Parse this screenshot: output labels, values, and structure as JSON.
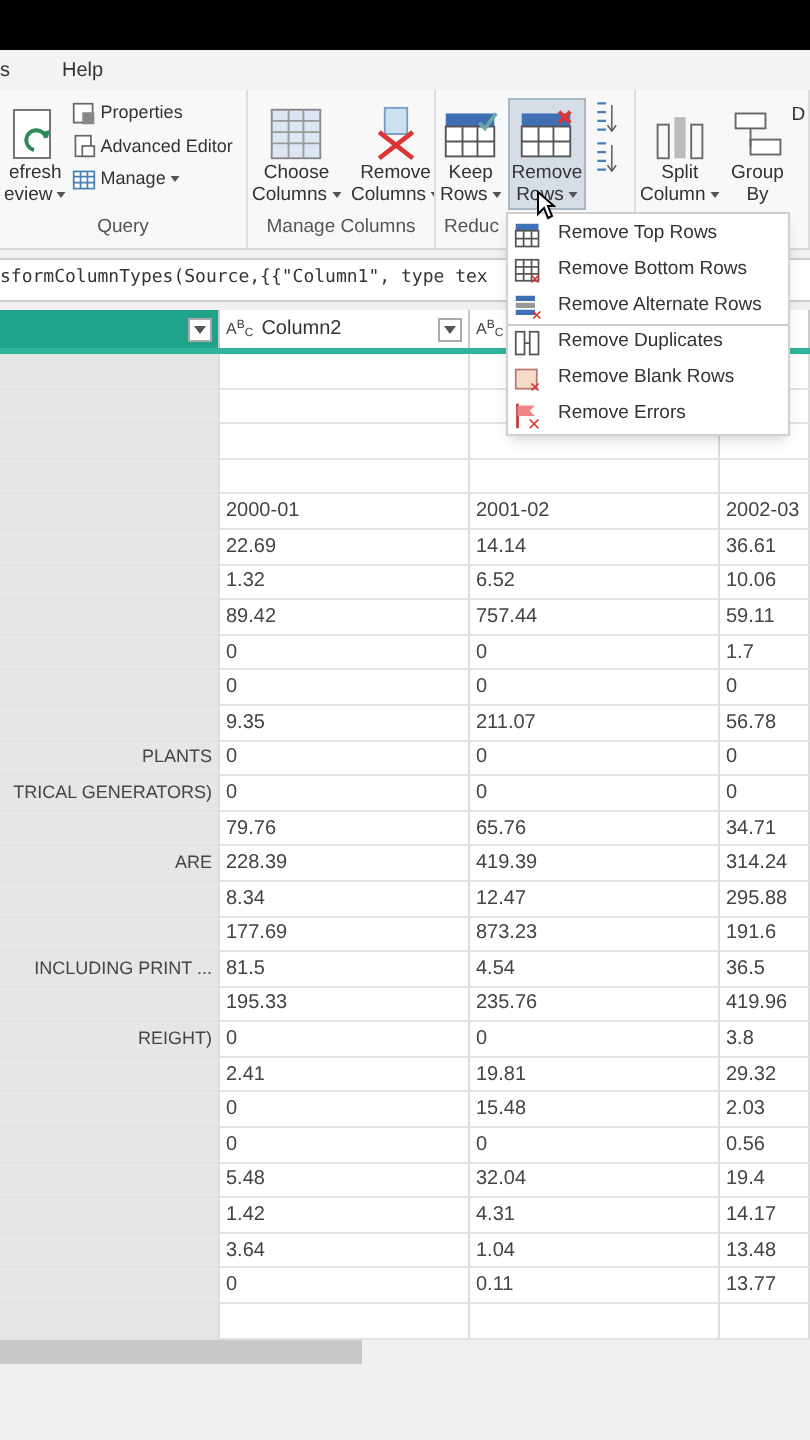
{
  "menu": [
    {
      "label": "s"
    },
    {
      "label": "Help"
    }
  ],
  "ribbon": {
    "groups": [
      {
        "label": "Query",
        "items": [
          {
            "kind": "large",
            "lines": [
              "efresh",
              "eview"
            ],
            "dropdown": true,
            "highlighted": false
          },
          {
            "kind": "stack",
            "entries": [
              {
                "label": "Properties",
                "dropdown": false
              },
              {
                "label": "Advanced Editor",
                "dropdown": false
              },
              {
                "label": "Manage",
                "dropdown": true
              }
            ]
          }
        ]
      },
      {
        "label": "Manage Columns",
        "items": [
          {
            "kind": "large",
            "lines": [
              "Choose",
              "Columns"
            ],
            "dropdown": true,
            "highlighted": false
          },
          {
            "kind": "large",
            "lines": [
              "Remove",
              "Columns"
            ],
            "dropdown": true,
            "highlighted": false
          }
        ]
      },
      {
        "label": "Reduc",
        "items": [
          {
            "kind": "large",
            "lines": [
              "Keep",
              "Rows"
            ],
            "dropdown": true,
            "highlighted": false
          },
          {
            "kind": "large",
            "lines": [
              "Remove",
              "Rows"
            ],
            "dropdown": true,
            "highlighted": true
          },
          {
            "kind": "sort"
          }
        ]
      },
      {
        "items": [
          {
            "kind": "large",
            "lines": [
              "Split",
              "Column"
            ],
            "dropdown": true,
            "highlighted": false
          },
          {
            "kind": "large",
            "lines": [
              "Group",
              "By"
            ],
            "dropdown": false,
            "highlighted": false
          },
          {
            "kind": "partial",
            "label": "D"
          }
        ]
      }
    ]
  },
  "formula": "sformColumnTypes(Source,{{\"Column1\", type tex",
  "dropdown_menu": [
    {
      "label": "Remove Top Rows",
      "separator_before": false
    },
    {
      "label": "Remove Bottom Rows",
      "separator_before": false
    },
    {
      "label": "Remove Alternate Rows",
      "separator_before": false
    },
    {
      "label": "Remove Duplicates",
      "separator_before": true
    },
    {
      "label": "Remove Blank Rows",
      "separator_before": false
    },
    {
      "label": "Remove Errors",
      "separator_before": false
    }
  ],
  "table": {
    "columns": [
      {},
      {
        "type_label": "A$^{B}$$_{C}$",
        "label": "Column2"
      },
      {
        "type_label": "A$^{B}$$_{C}$"
      },
      {}
    ],
    "rows": [
      [
        "",
        "",
        "",
        ""
      ],
      [
        "",
        "",
        "",
        ""
      ],
      [
        "",
        "",
        "",
        ""
      ],
      [
        "",
        "",
        "",
        ""
      ],
      [
        "",
        "2000-01",
        "2001-02",
        "2002-03"
      ],
      [
        "",
        "22.69",
        "14.14",
        "36.61"
      ],
      [
        "",
        "1.32",
        "6.52",
        "10.06"
      ],
      [
        "",
        "89.42",
        "757.44",
        "59.11"
      ],
      [
        "",
        "0",
        "0",
        "1.7"
      ],
      [
        "",
        "0",
        "0",
        "0"
      ],
      [
        "",
        "9.35",
        "211.07",
        "56.78"
      ],
      [
        " PLANTS",
        "0",
        "0",
        "0"
      ],
      [
        "TRICAL GENERATORS)",
        "0",
        "0",
        "0"
      ],
      [
        "",
        "79.76",
        "65.76",
        "34.71"
      ],
      [
        "ARE",
        "228.39",
        "419.39",
        "314.24"
      ],
      [
        "",
        "8.34",
        "12.47",
        "295.88"
      ],
      [
        "",
        "177.69",
        "873.23",
        "191.6"
      ],
      [
        " INCLUDING PRINT ...",
        "81.5",
        "4.54",
        "36.5"
      ],
      [
        "",
        "195.33",
        "235.76",
        "419.96"
      ],
      [
        "REIGHT)",
        "0",
        "0",
        "3.8"
      ],
      [
        "",
        "2.41",
        "19.81",
        "29.32"
      ],
      [
        "",
        "0",
        "15.48",
        "2.03"
      ],
      [
        "",
        "0",
        "0",
        "0.56"
      ],
      [
        "",
        "5.48",
        "32.04",
        "19.4"
      ],
      [
        "",
        "1.42",
        "4.31",
        "14.17"
      ],
      [
        "",
        "3.64",
        "1.04",
        "13.48"
      ],
      [
        "",
        "0",
        "0.11",
        "13.77"
      ],
      [
        "",
        "",
        "",
        ""
      ]
    ]
  }
}
